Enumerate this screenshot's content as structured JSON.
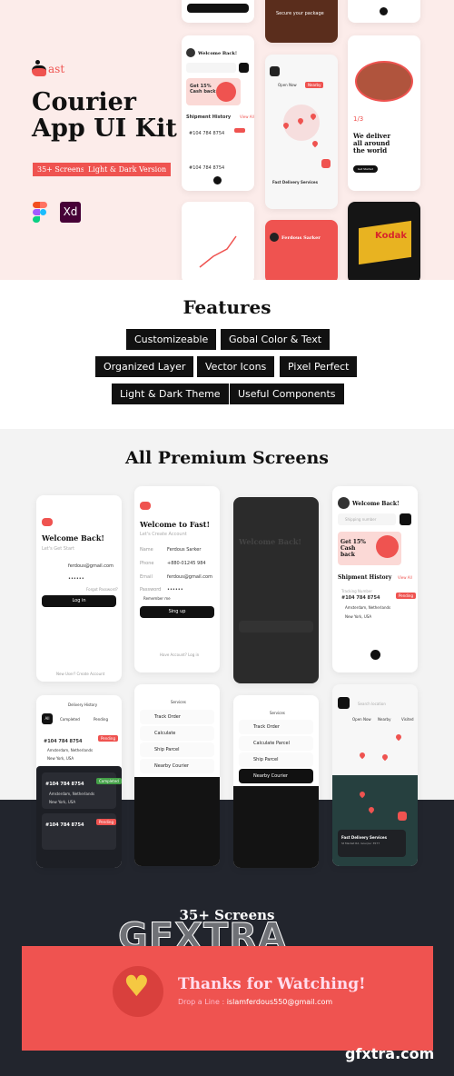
{
  "hero": {
    "logo_text": "ast",
    "title_line1": "Courier",
    "title_line2": "App UI Kit",
    "tags": [
      "35+ Screens",
      "Light & Dark Version"
    ],
    "tools": [
      "figma-icon",
      "xd-icon"
    ],
    "xd_label": "Xd",
    "onboarding": {
      "page": "1/3",
      "headline": "We deliver all around the world",
      "button": "Get Started"
    },
    "home": {
      "greeting": "Welcome Back!",
      "promo": "Get 15% Cash back",
      "section": "Shipment History",
      "view_all": "View All",
      "tracking": "#104 784 8754"
    },
    "map": {
      "chips": [
        "Open Now",
        "Nearby",
        "Visited"
      ],
      "service": "Fast Delivery Services"
    },
    "profile_name": "Ferdous Sarker",
    "secure_package": "Secure your package",
    "product_label": "Kodak"
  },
  "features": {
    "title": "Features",
    "items": [
      "Customizeable",
      "Gobal Color & Text",
      "Organized Layer",
      "Vector Icons",
      "Pixel Perfect",
      "Light & Dark Theme",
      "Useful Components"
    ]
  },
  "screens": {
    "title": "All Premium Screens",
    "login": {
      "title": "Welcome Back!",
      "sub": "Let's Get Start",
      "email": "ferdous@gmail.com",
      "password": "••••••",
      "forgot": "Forgot Password?",
      "button": "Log in",
      "footer": "New User? Create Account"
    },
    "signup": {
      "title": "Welcome to Fast!",
      "sub": "Let's Create Account",
      "fields": [
        [
          "Name",
          "Ferdous Sarker"
        ],
        [
          "Phone",
          "+880-01245 984"
        ],
        [
          "Email",
          "ferdous@gmail.com"
        ],
        [
          "Password",
          "••••••"
        ]
      ],
      "remember": "Remember me",
      "button": "Sing up",
      "footer": "Have Account? Log in"
    },
    "dark_login": {
      "title": "Welcome Back!"
    },
    "home": {
      "greeting": "Welcome Back!",
      "search": "Shipping number",
      "promo": "Get 15% Cash back",
      "section": "Shipment History",
      "view_all": "View All",
      "tracking_label": "Tracking Number",
      "tracking": "#104 784 8754",
      "from": "Amsterdam, Netherlands",
      "to": "New York, USA",
      "status": "Pending"
    },
    "history": {
      "title": "Delivery History",
      "tabs": [
        "All",
        "Completed",
        "Pending"
      ],
      "tracking": "#104 784 8754",
      "from": "Amsterdam, Netherlands",
      "to": "New York, USA",
      "statuses": [
        "Pending",
        "Completed",
        "Pending"
      ]
    },
    "services": {
      "title": "Services",
      "items": [
        "Track Order",
        "Calculate",
        "Ship Parcel",
        "Nearby Courier"
      ]
    },
    "services_dark": {
      "title": "Services",
      "items": [
        "Track Order",
        "Calculate Parcel",
        "Ship Parcel",
        "Nearby Courier"
      ]
    },
    "map": {
      "search": "Search location",
      "chips": [
        "Open Now",
        "Nearby",
        "Visited"
      ],
      "service": "Fast Delivery Services",
      "address": "St Market Rd, Gourpur 3577"
    }
  },
  "footer": {
    "count": "35+ Screens",
    "thanks": "Thanks for Watching!",
    "drop_label": "Drop a Line :",
    "email": "islamferdous550@gmail.com",
    "watermark": "GFXTRA",
    "site": "gfxtra.com"
  },
  "colors": {
    "accent": "#ef5350",
    "hero_bg": "#fcecea",
    "dark_bg": "#22252d",
    "heart": "#f5c842"
  }
}
